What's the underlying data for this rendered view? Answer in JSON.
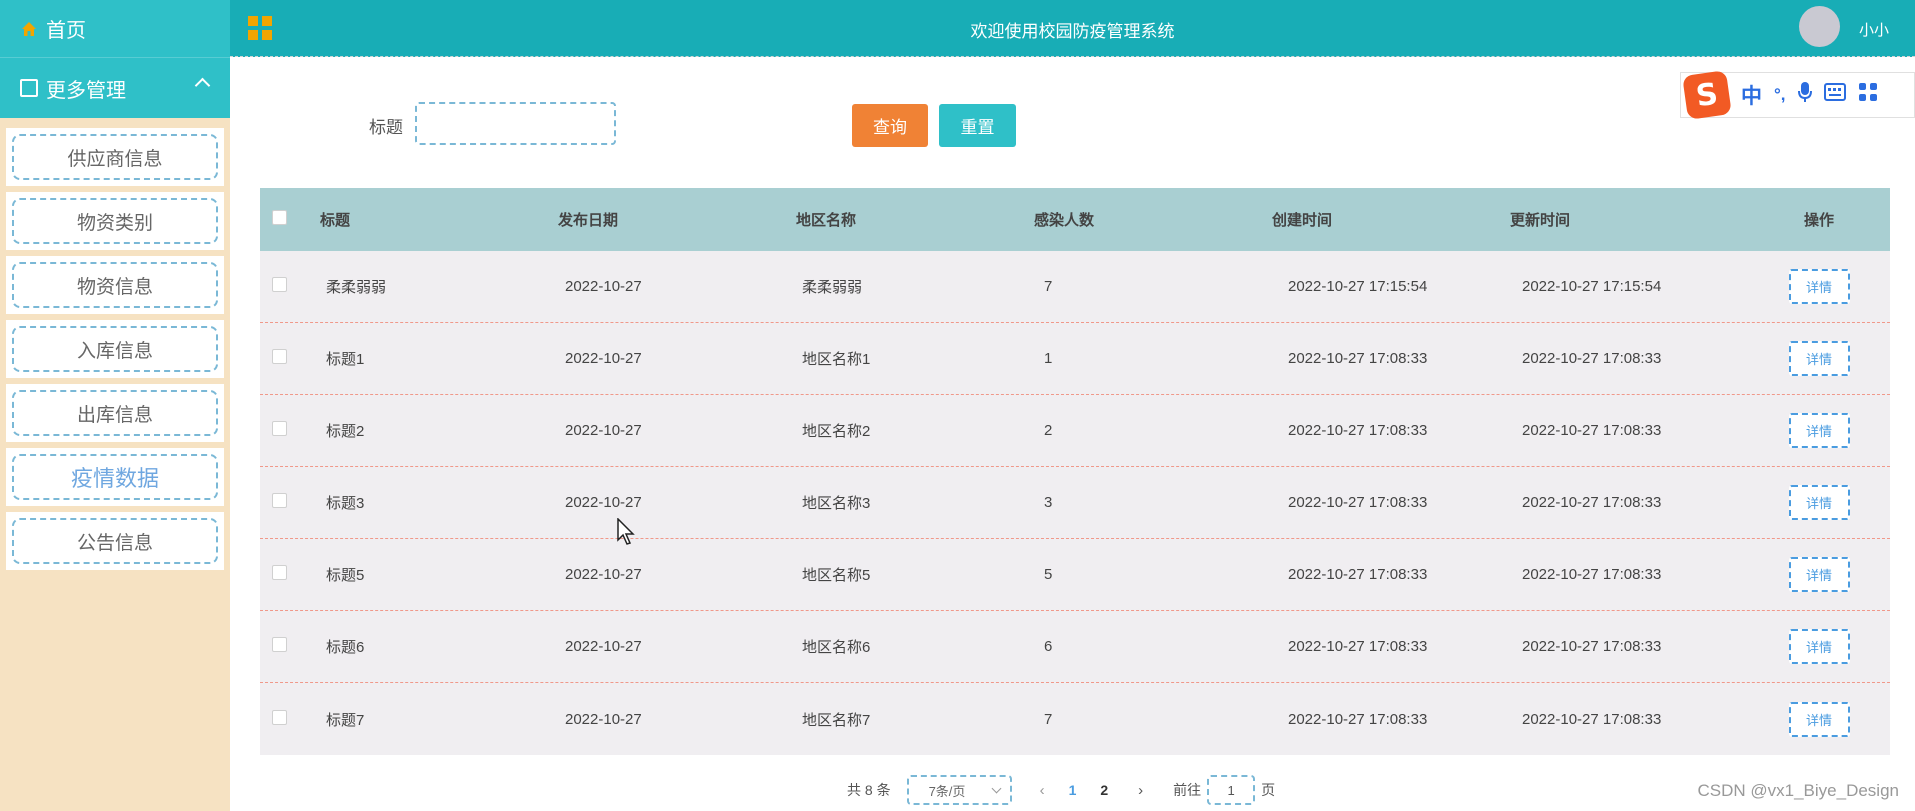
{
  "sidebar": {
    "home_label": "首页",
    "more_label": "更多管理",
    "items": [
      {
        "label": "供应商信息"
      },
      {
        "label": "物资类别"
      },
      {
        "label": "物资信息"
      },
      {
        "label": "入库信息"
      },
      {
        "label": "出库信息"
      },
      {
        "label": "疫情数据"
      },
      {
        "label": "公告信息"
      }
    ],
    "active_item": "疫情数据"
  },
  "header": {
    "title": "欢迎使用校园防疫管理系统",
    "username": "小小"
  },
  "search": {
    "label": "标题",
    "value": "",
    "query_button": "查询",
    "reset_button": "重置"
  },
  "ime_toolbar": {
    "items": [
      "中",
      "°,",
      "mic-icon",
      "keyboard-icon",
      "apps-icon"
    ]
  },
  "table": {
    "columns": [
      "标题",
      "发布日期",
      "地区名称",
      "感染人数",
      "创建时间",
      "更新时间",
      "操作"
    ],
    "rows": [
      {
        "title": "柔柔弱弱",
        "date": "2022-10-27",
        "region": "柔柔弱弱",
        "count": "7",
        "created": "2022-10-27 17:15:54",
        "updated": "2022-10-27 17:15:54",
        "action": "详情"
      },
      {
        "title": "标题1",
        "date": "2022-10-27",
        "region": "地区名称1",
        "count": "1",
        "created": "2022-10-27 17:08:33",
        "updated": "2022-10-27 17:08:33",
        "action": "详情"
      },
      {
        "title": "标题2",
        "date": "2022-10-27",
        "region": "地区名称2",
        "count": "2",
        "created": "2022-10-27 17:08:33",
        "updated": "2022-10-27 17:08:33",
        "action": "详情"
      },
      {
        "title": "标题3",
        "date": "2022-10-27",
        "region": "地区名称3",
        "count": "3",
        "created": "2022-10-27 17:08:33",
        "updated": "2022-10-27 17:08:33",
        "action": "详情"
      },
      {
        "title": "标题5",
        "date": "2022-10-27",
        "region": "地区名称5",
        "count": "5",
        "created": "2022-10-27 17:08:33",
        "updated": "2022-10-27 17:08:33",
        "action": "详情"
      },
      {
        "title": "标题6",
        "date": "2022-10-27",
        "region": "地区名称6",
        "count": "6",
        "created": "2022-10-27 17:08:33",
        "updated": "2022-10-27 17:08:33",
        "action": "详情"
      },
      {
        "title": "标题7",
        "date": "2022-10-27",
        "region": "地区名称7",
        "count": "7",
        "created": "2022-10-27 17:08:33",
        "updated": "2022-10-27 17:08:33",
        "action": "详情"
      }
    ]
  },
  "pagination": {
    "total": "共 8 条",
    "page_size": "7条/页",
    "prev": "‹",
    "pages": [
      "1",
      "2"
    ],
    "current_page": "1",
    "next": "›",
    "goto_label": "前往",
    "goto_value": "1",
    "goto_suffix": "页"
  },
  "watermark": "CSDN @vx1_Biye_Design",
  "colors": {
    "primary_teal": "#2fc0c8",
    "topbar_teal": "#18adb6",
    "sidebar_bg": "#f6e2c2",
    "query_orange": "#f08235",
    "table_header": "#a9cfd2",
    "dashed_border": "#7ab8d6",
    "row_divider": "#f0988a",
    "grid_icon": "#f2a500"
  }
}
